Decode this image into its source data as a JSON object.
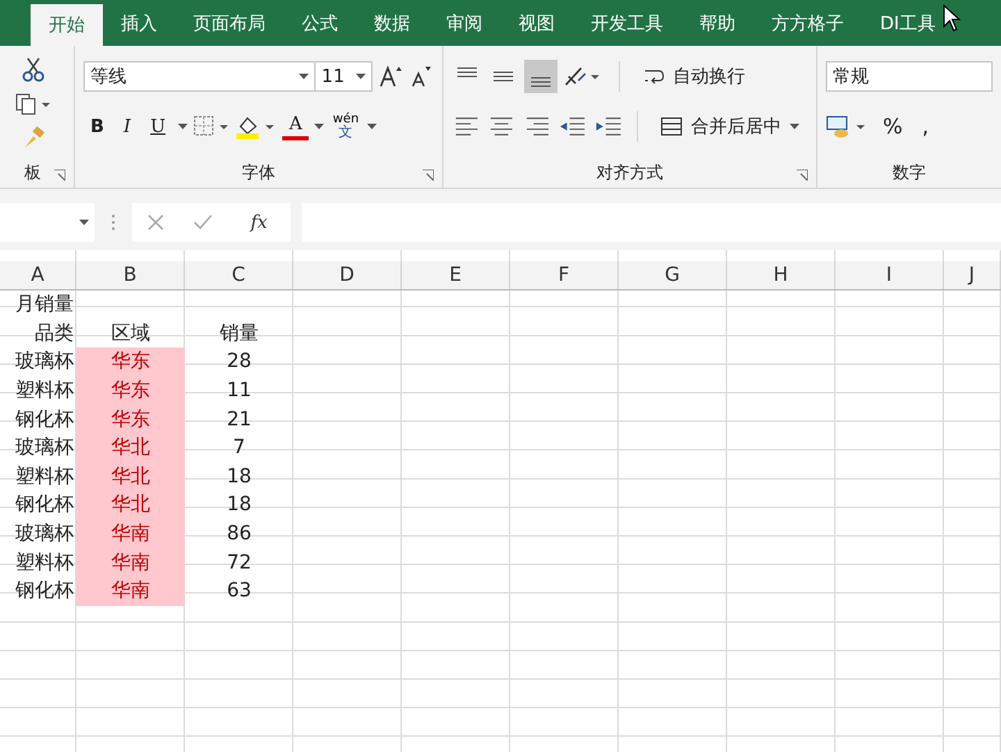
{
  "tabs": [
    {
      "label": "开始",
      "selected": true
    },
    {
      "label": "插入",
      "selected": false
    },
    {
      "label": "页面布局",
      "selected": false
    },
    {
      "label": "公式",
      "selected": false
    },
    {
      "label": "数据",
      "selected": false
    },
    {
      "label": "审阅",
      "selected": false
    },
    {
      "label": "视图",
      "selected": false
    },
    {
      "label": "开发工具",
      "selected": false
    },
    {
      "label": "帮助",
      "selected": false
    },
    {
      "label": "方方格子",
      "selected": false
    },
    {
      "label": "DI工具",
      "selected": false
    }
  ],
  "ribbon": {
    "clipboard_label": "板",
    "font": {
      "name": "等线",
      "size": "11",
      "bold": "B",
      "italic": "I",
      "underline": "U",
      "font_color": "A",
      "phonetic_top": "wén",
      "phonetic_bottom": "文",
      "label": "字体"
    },
    "alignment": {
      "wrap_text": "自动换行",
      "merge_center": "合并后居中",
      "label": "对齐方式"
    },
    "number": {
      "format": "常规",
      "percent": "%",
      "comma": ",",
      "label": "数字"
    }
  },
  "formula_bar": {
    "fx": "fx"
  },
  "columns": [
    "A",
    "B",
    "C",
    "D",
    "E",
    "F",
    "G",
    "H",
    "I",
    "J"
  ],
  "rows": [
    {
      "cells": [
        {
          "text": "月销量",
          "highlighted": false
        },
        {
          "text": "",
          "highlighted": false
        },
        {
          "text": "",
          "highlighted": false
        }
      ]
    },
    {
      "cells": [
        {
          "text": "品类",
          "highlighted": false
        },
        {
          "text": "区域",
          "highlighted": false
        },
        {
          "text": "销量",
          "highlighted": false
        }
      ]
    },
    {
      "cells": [
        {
          "text": "玻璃杯",
          "highlighted": false
        },
        {
          "text": "华东",
          "highlighted": true
        },
        {
          "text": "28",
          "highlighted": false
        }
      ]
    },
    {
      "cells": [
        {
          "text": "塑料杯",
          "highlighted": false
        },
        {
          "text": "华东",
          "highlighted": true
        },
        {
          "text": "11",
          "highlighted": false
        }
      ]
    },
    {
      "cells": [
        {
          "text": "钢化杯",
          "highlighted": false
        },
        {
          "text": "华东",
          "highlighted": true
        },
        {
          "text": "21",
          "highlighted": false
        }
      ]
    },
    {
      "cells": [
        {
          "text": "玻璃杯",
          "highlighted": false
        },
        {
          "text": "华北",
          "highlighted": true
        },
        {
          "text": "7",
          "highlighted": false
        }
      ]
    },
    {
      "cells": [
        {
          "text": "塑料杯",
          "highlighted": false
        },
        {
          "text": "华北",
          "highlighted": true
        },
        {
          "text": "18",
          "highlighted": false
        }
      ]
    },
    {
      "cells": [
        {
          "text": "钢化杯",
          "highlighted": false
        },
        {
          "text": "华北",
          "highlighted": true
        },
        {
          "text": "18",
          "highlighted": false
        }
      ]
    },
    {
      "cells": [
        {
          "text": "玻璃杯",
          "highlighted": false
        },
        {
          "text": "华南",
          "highlighted": true
        },
        {
          "text": "86",
          "highlighted": false
        }
      ]
    },
    {
      "cells": [
        {
          "text": "塑料杯",
          "highlighted": false
        },
        {
          "text": "华南",
          "highlighted": true
        },
        {
          "text": "72",
          "highlighted": false
        }
      ]
    },
    {
      "cells": [
        {
          "text": "钢化杯",
          "highlighted": false
        },
        {
          "text": "华南",
          "highlighted": true
        },
        {
          "text": "63",
          "highlighted": false
        }
      ]
    }
  ]
}
